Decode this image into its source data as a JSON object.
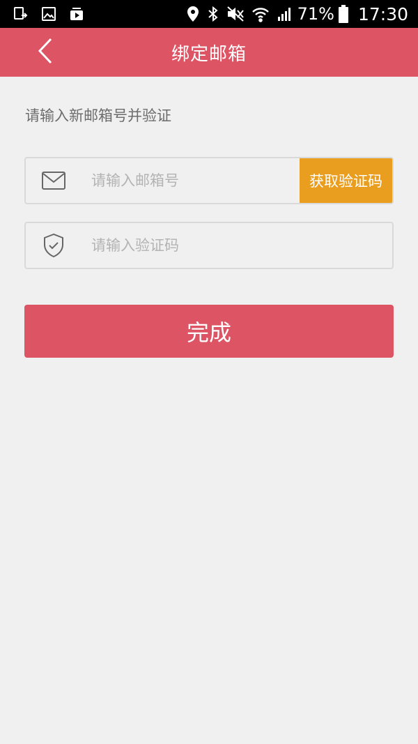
{
  "status_bar": {
    "battery_text": "71%",
    "time": "17:30"
  },
  "app_bar": {
    "title": "绑定邮箱",
    "back_icon": "chevron-left-icon",
    "color": "#dd5565"
  },
  "hint": "请输入新邮箱号并验证",
  "email_field": {
    "placeholder": "请输入邮箱号",
    "value": "",
    "icon": "mail-icon"
  },
  "get_code_button": {
    "label": "获取验证码",
    "color": "#e99e20"
  },
  "code_field": {
    "placeholder": "请输入验证码",
    "value": "",
    "icon": "shield-check-icon"
  },
  "submit_button": {
    "label": "完成"
  }
}
